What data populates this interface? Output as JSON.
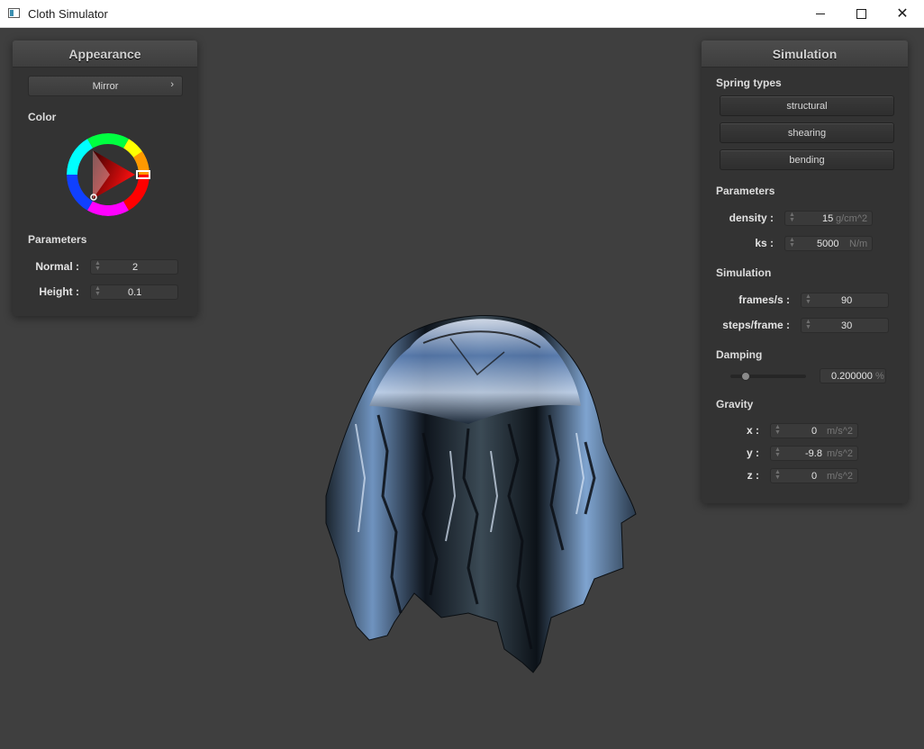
{
  "window": {
    "title": "Cloth Simulator",
    "minimize_icon": "minimize-icon",
    "maximize_icon": "maximize-icon",
    "close_glyph": "✕"
  },
  "appearance": {
    "title": "Appearance",
    "shader_select": {
      "value": "Mirror",
      "chevron": "›"
    },
    "color_label": "Color",
    "parameters_label": "Parameters",
    "normal": {
      "label": "Normal :",
      "value": "2"
    },
    "height": {
      "label": "Height :",
      "value": "0.1"
    },
    "color_wheel": {
      "hue": "red",
      "selected_color": "#ff0000"
    }
  },
  "simulation": {
    "title": "Simulation",
    "spring_types_label": "Spring types",
    "spring_buttons": [
      "structural",
      "shearing",
      "bending"
    ],
    "parameters_label": "Parameters",
    "density": {
      "label": "density :",
      "value": "15",
      "unit": "g/cm^2"
    },
    "ks": {
      "label": "ks :",
      "value": "5000",
      "unit": "N/m"
    },
    "simulation_label": "Simulation",
    "frames": {
      "label": "frames/s :",
      "value": "90"
    },
    "steps": {
      "label": "steps/frame :",
      "value": "30"
    },
    "damping_label": "Damping",
    "damping": {
      "value": "0.200000",
      "unit": "%",
      "slider_fraction": 0.2
    },
    "gravity_label": "Gravity",
    "gravity": [
      {
        "label": "x :",
        "value": "0",
        "unit": "m/s^2"
      },
      {
        "label": "y :",
        "value": "-9.8",
        "unit": "m/s^2"
      },
      {
        "label": "z :",
        "value": "0",
        "unit": "m/s^2"
      }
    ]
  },
  "colors": {
    "background": "#3f3f3f",
    "panel": "#333333",
    "selected_hue": "#ff0000"
  }
}
